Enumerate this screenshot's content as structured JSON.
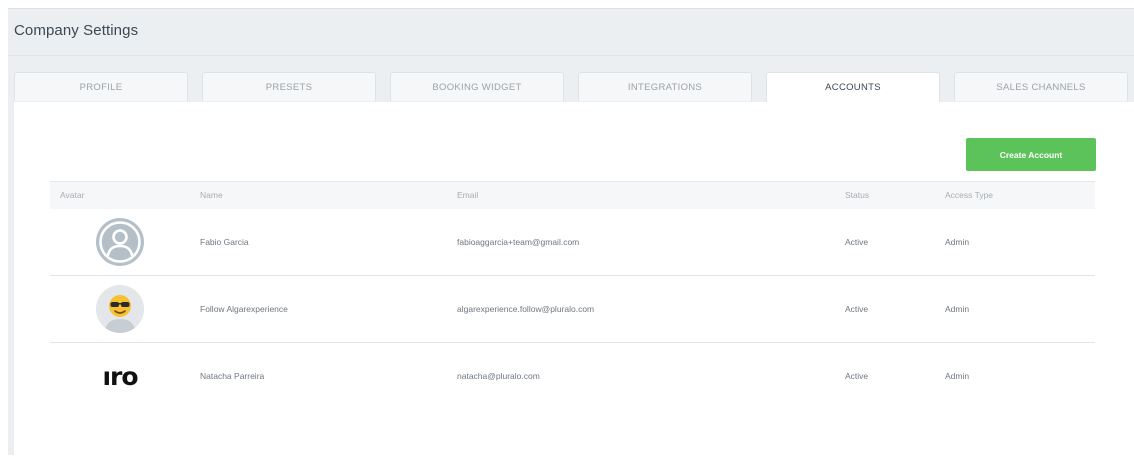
{
  "header": {
    "title": "Company Settings"
  },
  "tabs": [
    {
      "label": "PROFILE",
      "active": false
    },
    {
      "label": "PRESETS",
      "active": false
    },
    {
      "label": "BOOKING WIDGET",
      "active": false
    },
    {
      "label": "INTEGRATIONS",
      "active": false
    },
    {
      "label": "ACCOUNTS",
      "active": true
    },
    {
      "label": "SALES CHANNELS",
      "active": false
    }
  ],
  "actions": {
    "create_account_label": "Create Account"
  },
  "table": {
    "columns": [
      "Avatar",
      "Name",
      "Email",
      "Status",
      "Access Type"
    ],
    "rows": [
      {
        "avatar": "generic-user-icon",
        "name": "Fabio Garcia",
        "email": "fabioaggarcia+team@gmail.com",
        "status": "Active",
        "access_type": "Admin"
      },
      {
        "avatar": "sunglasses-emoji-icon",
        "name": "Follow Algarexperience",
        "email": "algarexperience.follow@pluralo.com",
        "status": "Active",
        "access_type": "Admin"
      },
      {
        "avatar": "logo-image",
        "avatar_text": "ıro",
        "name": "Natacha Parreira",
        "email": "natacha@pluralo.com",
        "status": "Active",
        "access_type": "Admin"
      }
    ]
  },
  "colors": {
    "background": "#eceff1",
    "panel": "#ffffff",
    "accent_button": "#5cc35a",
    "active_tab_text": "#3d4852",
    "inactive_tab_text": "#9aa2a9"
  }
}
